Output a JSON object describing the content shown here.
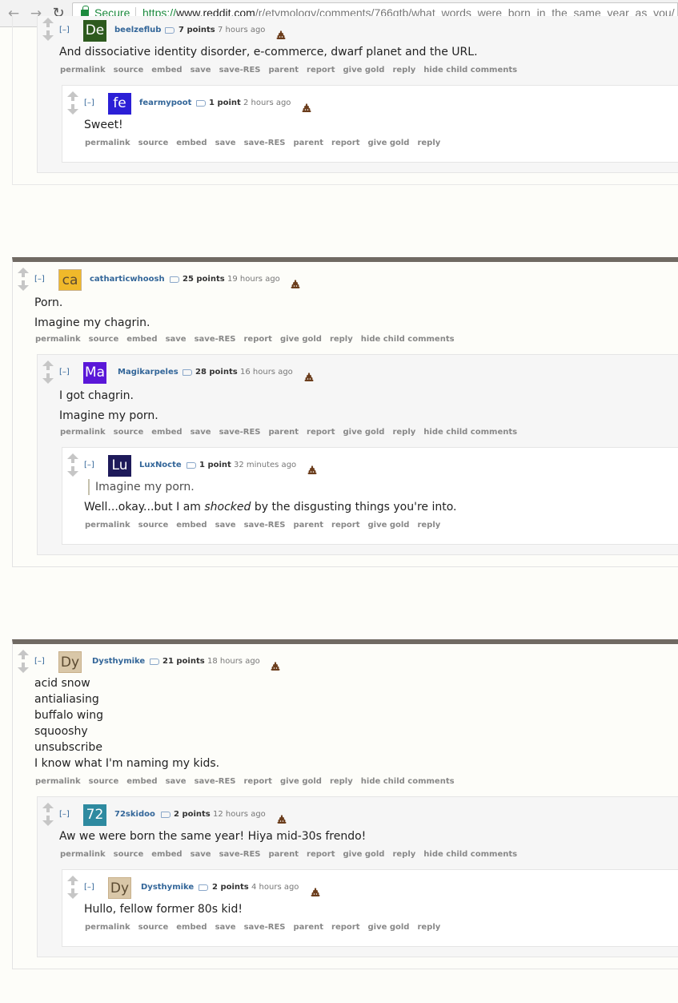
{
  "browser": {
    "secure_label": "Secure",
    "url_scheme": "https://",
    "url_host": "www.reddit.com",
    "url_path": "/r/etymology/comments/766qtb/what_words_were_born_in_the_same_year_as_you/"
  },
  "labels": {
    "collapse": "[–]"
  },
  "comments": [
    {
      "avatar_text": "De",
      "avatar_color": "#2d5a1e",
      "author": "beelzeflub",
      "score": "7 points",
      "time": "7 hours ago",
      "body": [
        "And dissociative identity disorder, e-commerce, dwarf planet and the URL."
      ],
      "buttons": [
        "permalink",
        "source",
        "embed",
        "save",
        "save-RES",
        "parent",
        "report",
        "give gold",
        "reply",
        "hide child comments"
      ]
    },
    {
      "avatar_text": "fe",
      "avatar_color": "#2b1fd6",
      "author": "fearmypoot",
      "score": "1 point",
      "time": "2 hours ago",
      "body": [
        "Sweet!"
      ],
      "buttons": [
        "permalink",
        "source",
        "embed",
        "save",
        "save-RES",
        "parent",
        "report",
        "give gold",
        "reply"
      ]
    },
    {
      "avatar_text": "ca",
      "avatar_color": "#f0b92a",
      "author": "catharticwhoosh",
      "score": "25 points",
      "time": "19 hours ago",
      "body": [
        "Porn.",
        "Imagine my chagrin."
      ],
      "buttons": [
        "permalink",
        "source",
        "embed",
        "save",
        "save-RES",
        "report",
        "give gold",
        "reply",
        "hide child comments"
      ]
    },
    {
      "avatar_text": "Ma",
      "avatar_color": "#5a17d8",
      "author": "Magikarpeles",
      "score": "28 points",
      "time": "16 hours ago",
      "body": [
        "I got chagrin.",
        "Imagine my porn."
      ],
      "buttons": [
        "permalink",
        "source",
        "embed",
        "save",
        "save-RES",
        "parent",
        "report",
        "give gold",
        "reply",
        "hide child comments"
      ]
    },
    {
      "avatar_text": "Lu",
      "avatar_color": "#1e1a5a",
      "author": "LuxNocte",
      "score": "1 point",
      "time": "32 minutes ago",
      "quote": "Imagine my porn.",
      "body_pre": "Well...okay...but I am ",
      "body_em": "shocked",
      "body_post": " by the disgusting things you're into.",
      "buttons": [
        "permalink",
        "source",
        "embed",
        "save",
        "save-RES",
        "parent",
        "report",
        "give gold",
        "reply"
      ]
    },
    {
      "avatar_text": "Dy",
      "avatar_color": "#d9c7a8",
      "author": "Dysthymike",
      "score": "21 points",
      "time": "18 hours ago",
      "body": [
        "acid snow",
        "antialiasing",
        "buffalo wing",
        "squooshy",
        "unsubscribe",
        "I know what I'm naming my kids."
      ],
      "buttons": [
        "permalink",
        "source",
        "embed",
        "save",
        "save-RES",
        "report",
        "give gold",
        "reply",
        "hide child comments"
      ]
    },
    {
      "avatar_text": "72",
      "avatar_color": "#2e8aa0",
      "author": "72skidoo",
      "score": "2 points",
      "time": "12 hours ago",
      "body": [
        "Aw we were born the same year! Hiya mid-30s frendo!"
      ],
      "buttons": [
        "permalink",
        "source",
        "embed",
        "save",
        "save-RES",
        "parent",
        "report",
        "give gold",
        "reply",
        "hide child comments"
      ]
    },
    {
      "avatar_text": "Dy",
      "avatar_color": "#d9c7a8",
      "author": "Dysthymike",
      "score": "2 points",
      "time": "4 hours ago",
      "body": [
        "Hullo, fellow former 80s kid!"
      ],
      "buttons": [
        "permalink",
        "source",
        "embed",
        "save",
        "save-RES",
        "parent",
        "report",
        "give gold",
        "reply"
      ]
    }
  ]
}
